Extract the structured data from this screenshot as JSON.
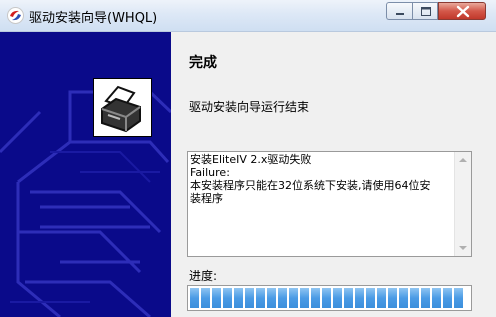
{
  "window": {
    "title": "驱动安装向导(WHQL)"
  },
  "controls": {
    "minimize_icon": "minimize-icon",
    "maximize_icon": "maximize-icon",
    "close_icon": "close-icon"
  },
  "main": {
    "heading": "完成",
    "subtext": "驱动安装向导运行结束"
  },
  "log": {
    "lines": "安装EliteIV 2.x驱动失败\nFailure:\n本安装程序只能在32位系统下安装,请使用64位安\n装程序"
  },
  "progress": {
    "label": "进度:",
    "value_percent": 100
  },
  "colors": {
    "banner": "#0a0a8a",
    "progress": "#4a9be5",
    "close_button": "#c1382b"
  }
}
